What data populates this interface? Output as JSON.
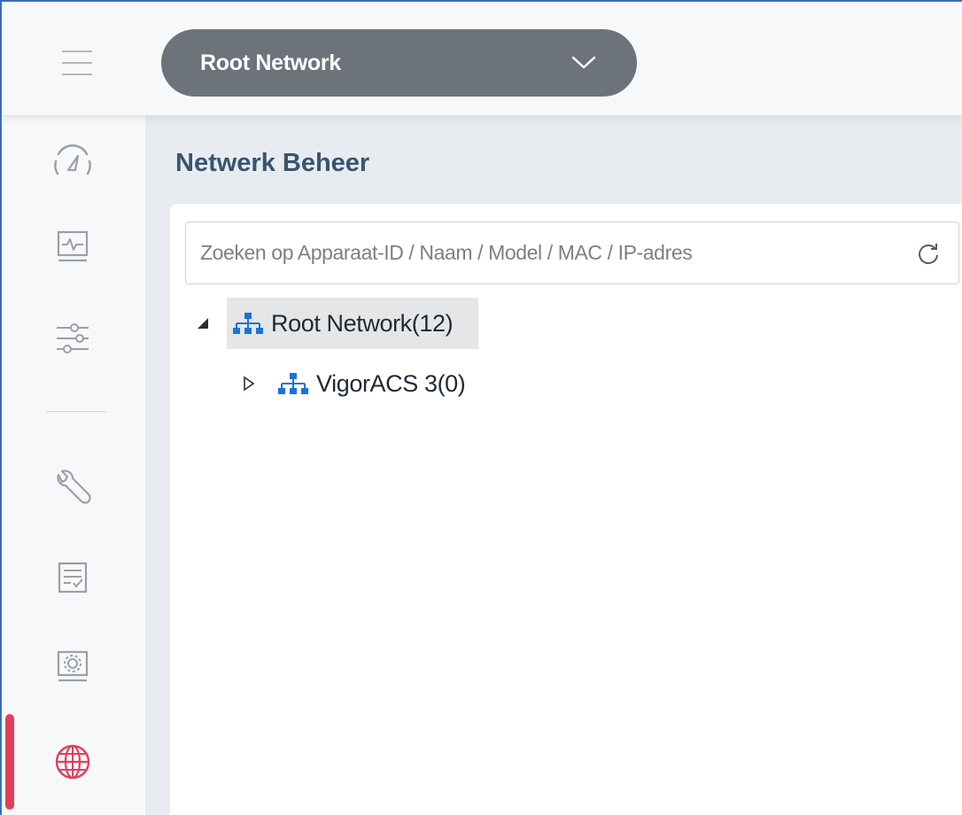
{
  "header": {
    "menu_icon": "hamburger-menu-icon",
    "network_select": {
      "value": "Root Network",
      "icon": "chevron-down-icon"
    }
  },
  "sidebar": {
    "items": [
      {
        "id": "dashboard",
        "icon": "speedometer-icon"
      },
      {
        "id": "monitoring",
        "icon": "monitor-pulse-icon"
      },
      {
        "id": "configuration",
        "icon": "sliders-icon"
      },
      {
        "id": "maintenance",
        "icon": "wrench-icon"
      },
      {
        "id": "reports",
        "icon": "checklist-icon"
      },
      {
        "id": "system",
        "icon": "monitor-gear-icon"
      },
      {
        "id": "network-management",
        "icon": "globe-icon",
        "active": true
      }
    ],
    "active_color": "#e0405a"
  },
  "main": {
    "title": "Netwerk Beheer",
    "search": {
      "placeholder": "Zoeken op Apparaat-ID / Naam / Model / MAC / IP-adres",
      "value": ""
    },
    "tree": [
      {
        "label": "Root Network(12)",
        "expanded": true,
        "selected": true,
        "icon": "network-tree-icon",
        "children": [
          {
            "label": "VigorACS 3(0)",
            "expanded": false,
            "icon": "network-tree-icon"
          }
        ]
      }
    ]
  },
  "colors": {
    "accent_blue": "#1a73d9",
    "select_bg": "#6d737b",
    "title_color": "#3a5470",
    "frame_border": "#3d6eb5"
  }
}
